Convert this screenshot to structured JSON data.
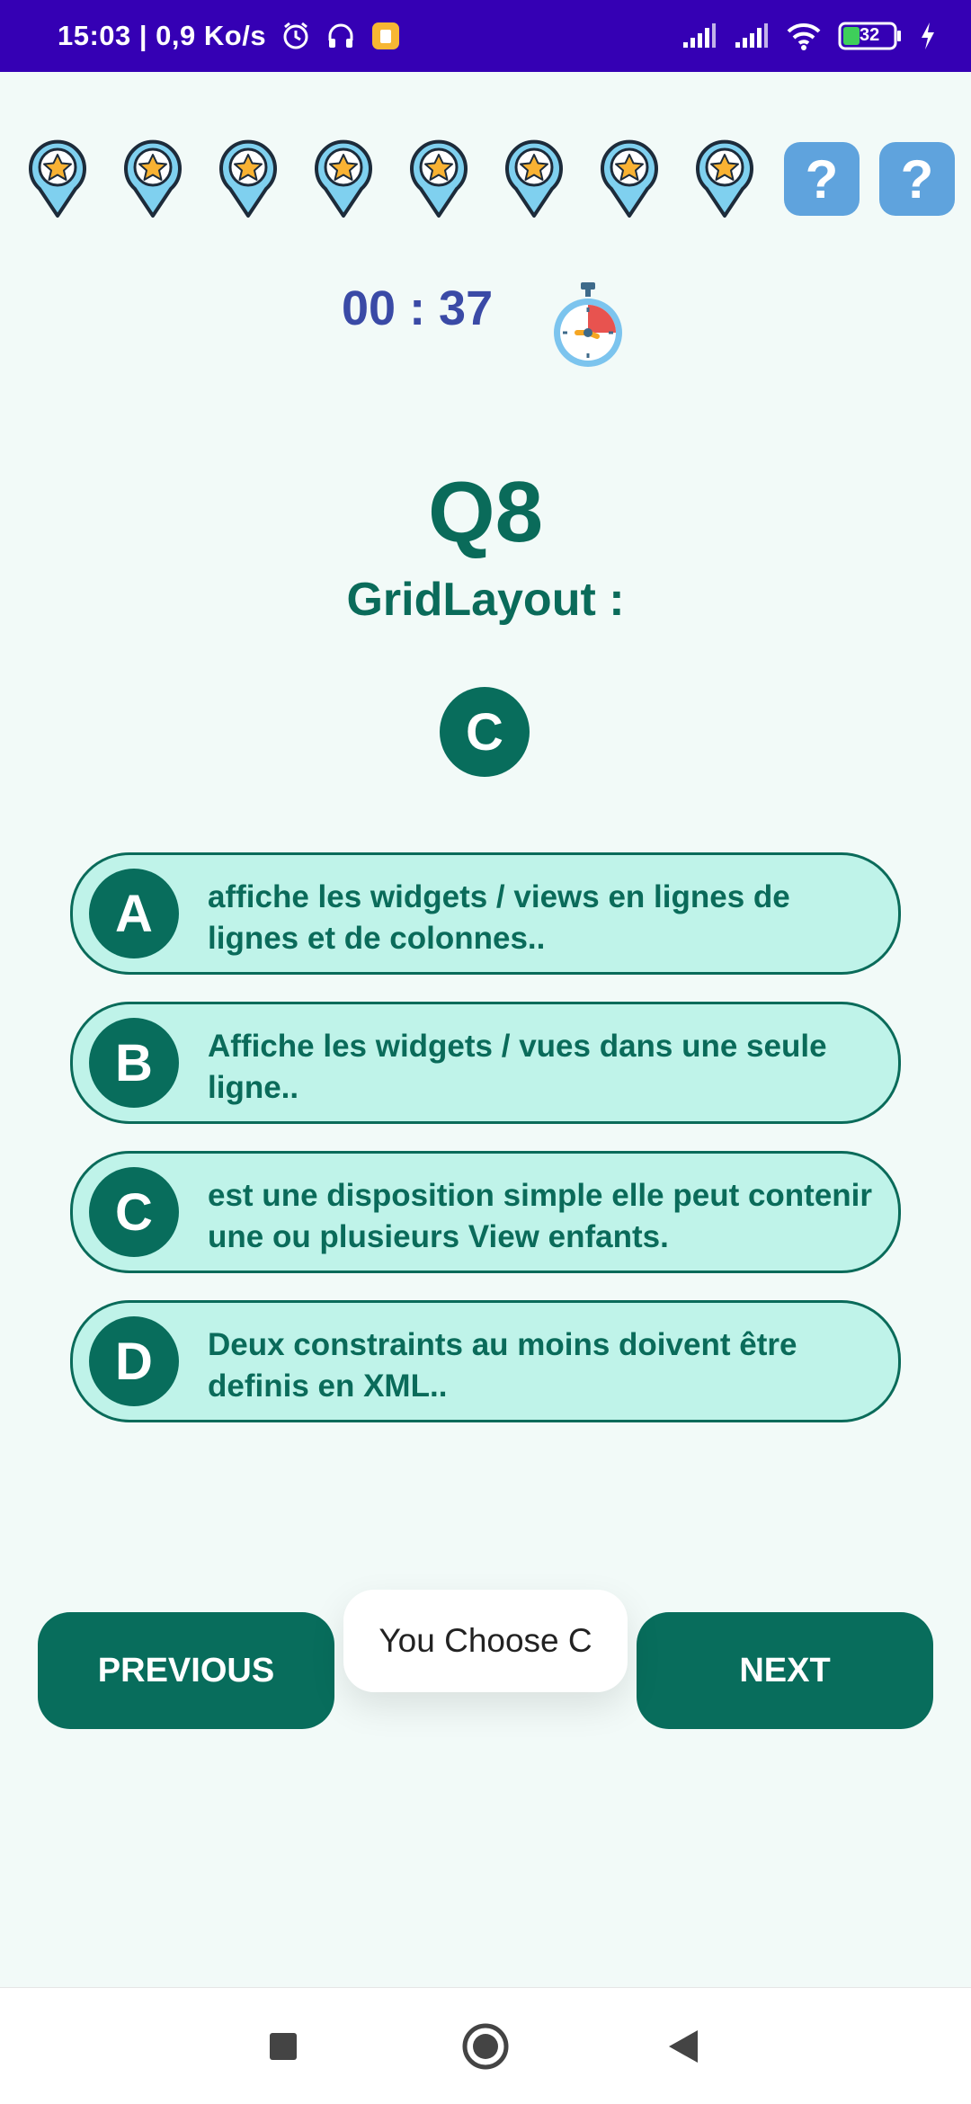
{
  "status_bar": {
    "time_speed": "15:03 | 0,9 Ko/s",
    "battery_level": "32",
    "icons": [
      "alarm-icon",
      "headset-icon",
      "app-notification-icon",
      "signal-icon",
      "signal-icon",
      "wifi-icon",
      "battery-icon",
      "charging-icon"
    ]
  },
  "hints": {
    "star_pins": 8,
    "unknown_label": "?",
    "unknown_count": 2
  },
  "timer": {
    "text": "00 : 37",
    "icon": "stopwatch-icon"
  },
  "question": {
    "number": "Q8",
    "text": "GridLayout :",
    "selected_letter": "C"
  },
  "options": [
    {
      "letter": "A",
      "text": "affiche les widgets / views en lignes de lignes et de colonnes.."
    },
    {
      "letter": "B",
      "text": "Affiche les widgets / vues dans une seule ligne.."
    },
    {
      "letter": "C",
      "text": "est une disposition simple elle peut contenir une ou plusieurs View enfants."
    },
    {
      "letter": "D",
      "text": "Deux constraints au moins doivent être definis en XML.."
    }
  ],
  "buttons": {
    "previous": "PREVIOUS",
    "next": "NEXT"
  },
  "toast": {
    "text": "You Choose C"
  },
  "colors": {
    "status_bar": "#3500b4",
    "primary": "#086d5c",
    "option_fill": "#bff3e9",
    "timer": "#3a4aa6",
    "hint_blue": "#5fa3dd",
    "background": "#f2faf8"
  }
}
